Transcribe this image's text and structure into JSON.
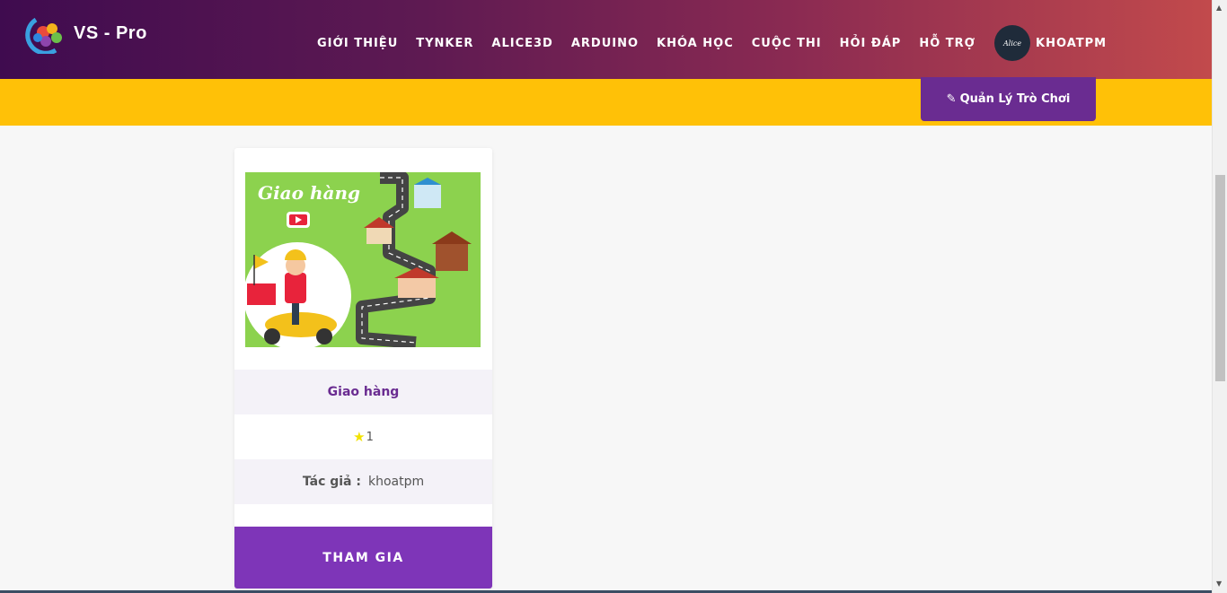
{
  "header": {
    "logo_text": "VS - Pro",
    "nav": [
      "GIỚI THIỆU",
      "TYNKER",
      "ALICE3D",
      "ARDUINO",
      "KHÓA HỌC",
      "CUỘC THI",
      "HỎI ĐÁP",
      "HỖ TRỢ"
    ],
    "user_name": "KHOATPM",
    "avatar_text": "Alice"
  },
  "toolbar": {
    "manage_label": "Quản Lý Trò Chơi"
  },
  "card": {
    "image_title": "Giao hàng",
    "title": "Giao hàng",
    "rating": "1",
    "author_label": "Tác giả :",
    "author": "khoatpm",
    "join_label": "THAM GIA"
  },
  "colors": {
    "accent": "#6a2c91",
    "band": "#ffc107",
    "join": "#7e35b8"
  }
}
